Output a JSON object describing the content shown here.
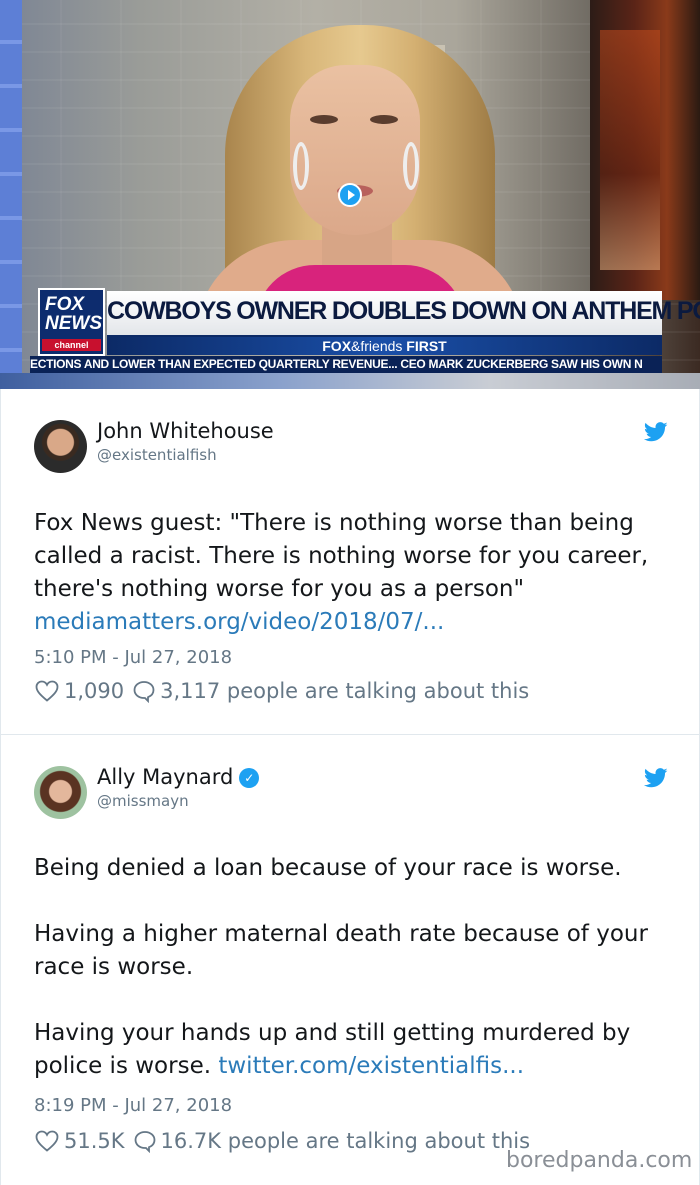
{
  "video": {
    "logo_line1": "FOX",
    "logo_line2": "NEWS",
    "logo_line3": "channel",
    "headline": "COWBOYS OWNER DOUBLES DOWN ON ANTHEM POLICY",
    "show_bold": "FOX",
    "show_rest": "&friends",
    "show_end": "FIRST",
    "ticker": "ECTIONS AND LOWER THAN EXPECTED QUARTERLY REVENUE...  CEO MARK ZUCKERBERG SAW HIS OWN N"
  },
  "tweets": [
    {
      "name": "John Whitehouse",
      "handle": "@existentialfish",
      "verified": false,
      "text_lines": [
        "Fox News guest: \"There is nothing worse than being called a racist. There is nothing worse for you career, there's nothing worse for you as a person\""
      ],
      "link": "mediamatters.org/video/2018/07/...",
      "time": "5:10 PM - Jul 27, 2018",
      "likes": "1,090",
      "talking": "3,117 people are talking about this"
    },
    {
      "name": "Ally Maynard",
      "handle": "@missmayn",
      "verified": true,
      "para1": "Being denied a loan because of your race is worse.",
      "para2": "Having a higher maternal death rate because of your race is worse.",
      "para3": "Having your hands up and still getting murdered by police is worse.",
      "link": "twitter.com/existentialfis...",
      "time": "8:19 PM - Jul 27, 2018",
      "likes": "51.5K",
      "talking": "16.7K people are talking about this"
    }
  ],
  "watermark": "boredpanda.com",
  "colors": {
    "twitter_blue": "#1da1f2",
    "link": "#2b7bb9",
    "muted": "#657786"
  }
}
